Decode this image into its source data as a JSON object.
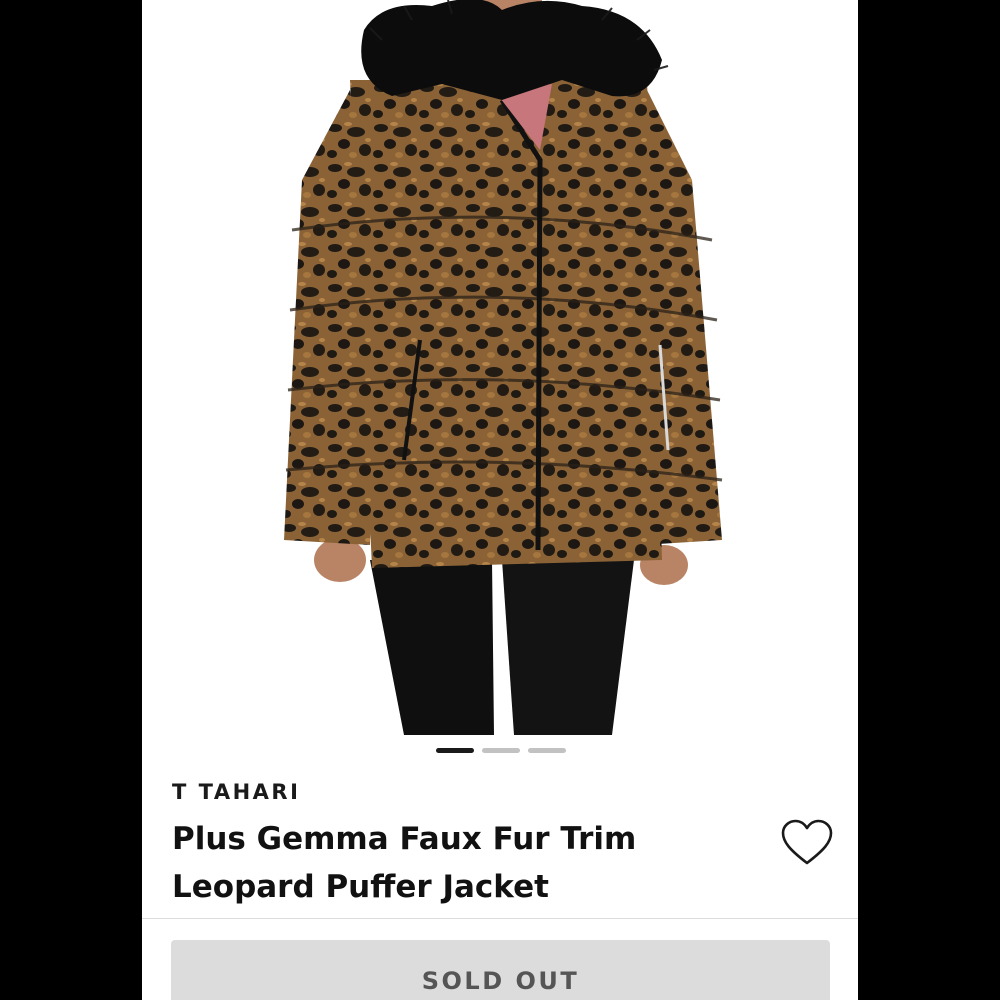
{
  "product": {
    "brand": "T TAHARI",
    "title_line1": "Plus Gemma Faux Fur Trim",
    "title_line2": "Leopard Puffer Jacket",
    "image_alt": "Plus Gemma Faux Fur Trim Leopard Puffer Jacket",
    "wishlist_icon": "heart-outline-icon"
  },
  "carousel": {
    "image_count": 3,
    "active_index": 0
  },
  "actions": {
    "button_label": "SOLD OUT"
  },
  "colors": {
    "bezel": "#000000",
    "screen_bg": "#ffffff",
    "button_bg": "#dcdcdc",
    "button_text": "#555555",
    "dot_active": "#1a1a1a",
    "dot_inactive": "#c2c2c2"
  }
}
